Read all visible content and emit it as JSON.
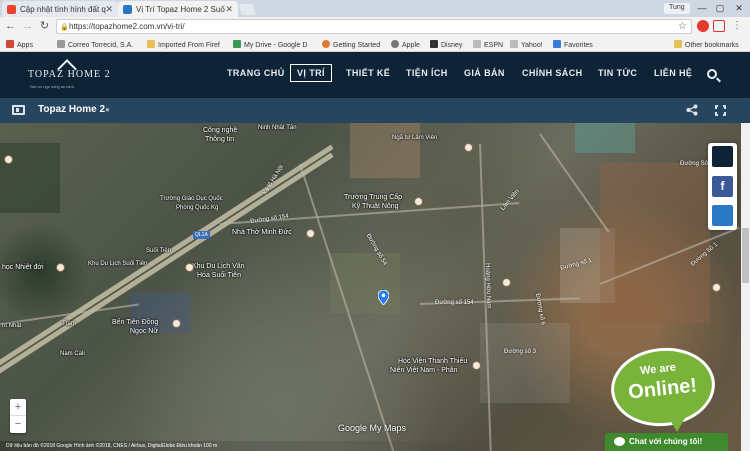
{
  "browser": {
    "tabs": [
      {
        "title": "Cập nhật tình hình đất q",
        "favicon_color": "#e8442e"
      },
      {
        "title": "Vị Trí Topaz Home 2 Suố",
        "favicon_color": "#2a78c5"
      }
    ],
    "profile": "Tung",
    "window_controls": {
      "minimize": "—",
      "maximize": "▢",
      "close": "✕"
    },
    "nav": {
      "back": "←",
      "forward": "→",
      "reload": "↻"
    },
    "url": "https://topazhome2.com.vn/vi-tri/",
    "bookmarks": [
      {
        "label": "Apps",
        "color": "#d14836"
      },
      {
        "label": "Correo Torrecid, S.A.",
        "color": "#999999"
      },
      {
        "label": "Imported From Firef",
        "color": "#e8c05a"
      },
      {
        "label": "My Drive - Google D",
        "color": "#3b9a56"
      },
      {
        "label": "Getting Started",
        "color": "#e07a2e"
      },
      {
        "label": "Apple",
        "color": "#777777"
      },
      {
        "label": "Disney",
        "color": "#333333"
      },
      {
        "label": "ESPN",
        "color": "#bbbbbb"
      },
      {
        "label": "Yahoo!",
        "color": "#bbbbbb"
      },
      {
        "label": "Favorites",
        "color": "#3a7bd5"
      }
    ],
    "other_bookmarks": "Other bookmarks"
  },
  "site": {
    "logo_text": "TOPAZ HOME 2",
    "logo_tagline": "Nơi cư ngụ sống an lành",
    "nav": [
      "TRANG CHỦ",
      "VỊ TRÍ",
      "THIẾT KẾ",
      "TIỆN ÍCH",
      "GIÁ BÁN",
      "CHÍNH SÁCH",
      "TIN TỨC",
      "LIÊN HỆ"
    ],
    "active_nav": "VỊ TRÍ"
  },
  "map": {
    "title": "Topaz Home 2",
    "labels": [
      "Công nghệ",
      "Thông tin",
      "Trường Giáo Dục Quốc",
      "Phòng Quốc Kg",
      "Nhà Thờ Minh Đức",
      "Trường Trung Cấp",
      "Kỹ Thuật Nông",
      "Khu Du Lịch Văn",
      "Hóa Suối Tiên",
      "Khu Du Lịch Suối Tiên",
      "Bến Tiên Đồng",
      "Ngọc Nữ",
      "Học Viện Thanh Thiếu",
      "Niên Việt Nam - Phân",
      "học Nhiệt đới",
      "Trạm",
      "Suối Tiên",
      "Nam Cali",
      "ht Nhật",
      "Ngã tư Lâm Viên",
      "Ninh Nhật Tân"
    ],
    "roads": [
      "Xa lộ Hà Nội",
      "Đường số 154",
      "Đường số 1",
      "Đường số 154",
      "Đường số 3",
      "Đường số 54",
      "Đường số 6",
      "Hoàng Hữu Nam",
      "Đường Sô 1",
      "Đường Sô 1",
      "Lâm Viên"
    ],
    "shield": "QL1A",
    "zoom_in": "+",
    "zoom_out": "−",
    "footer": "Dữ liệu bản đồ ©2018 Google Hình ảnh ©2018, CNES / Airbus, DigitalGlobe  Điều khoản  100 m",
    "mymaps": "Google My Maps"
  },
  "social": {
    "facebook": "f"
  },
  "badge": {
    "line1": "We are",
    "line2": "Online!"
  },
  "chat": {
    "label": "Chat với chúng tôi!"
  }
}
